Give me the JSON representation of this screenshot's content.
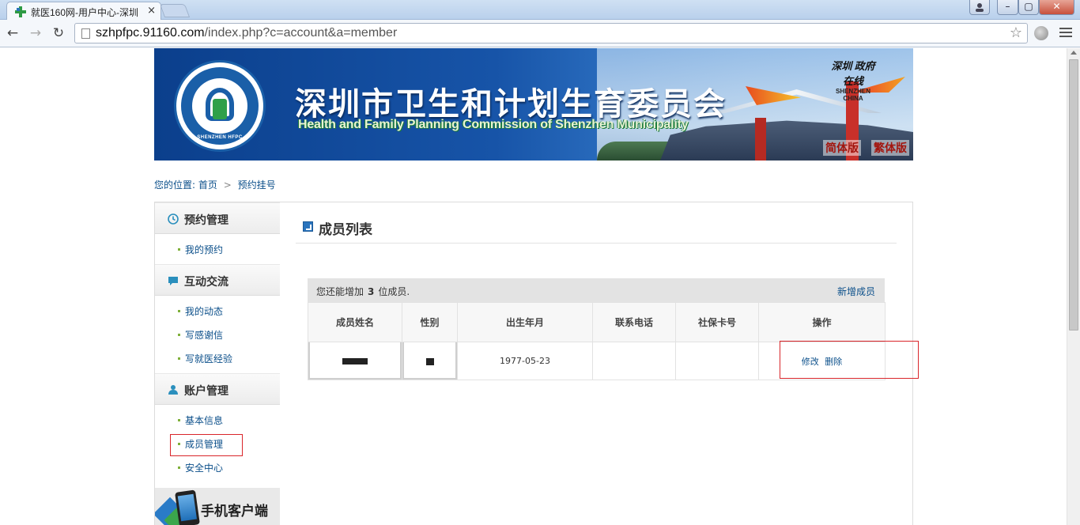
{
  "browser": {
    "tab_title": "就医160网-用户中心-深圳",
    "tab_close": "×",
    "url_host": "szhpfpc.91160.com",
    "url_path": "/index.php?c=account&a=member",
    "star": "☆",
    "win_min": "–",
    "win_max": "▢",
    "win_close": "✕",
    "icons": [
      "back-arrow-icon",
      "forward-arrow-icon",
      "reload-icon",
      "page-icon",
      "bookmark-star-icon",
      "extension-icon",
      "menu-icon"
    ]
  },
  "banner": {
    "cn_title": "深圳市卫生和计划生育委员会",
    "en_title": "Health and Family Planning Commission of Shenzhen Municipality",
    "emblem_text": "SHENZHEN HFPC",
    "sz_logo_cn": "深圳 政府在线",
    "sz_logo_en": "SHENZHEN CHINA",
    "lang_simplified": "简体版",
    "lang_traditional": "繁体版",
    "colors": {
      "primary": "#0b3f8c",
      "accent_red": "#a3150e"
    }
  },
  "breadcrumb": {
    "prefix": "您的位置:",
    "home": "首页",
    "separator": ">",
    "current": "预约挂号"
  },
  "sidebar": {
    "sections": [
      {
        "title": "预约管理",
        "icon": "clock-icon",
        "items": [
          {
            "label": "我的预约"
          }
        ]
      },
      {
        "title": "互动交流",
        "icon": "chat-bubble-icon",
        "items": [
          {
            "label": "我的动态"
          },
          {
            "label": "写感谢信"
          },
          {
            "label": "写就医经验"
          }
        ]
      },
      {
        "title": "账户管理",
        "icon": "user-icon",
        "items": [
          {
            "label": "基本信息"
          },
          {
            "label": "成员管理",
            "active": true
          },
          {
            "label": "安全中心"
          }
        ]
      }
    ],
    "app_promo": "手机客户端"
  },
  "main": {
    "title": "成员列表",
    "quota_prefix": "您还能增加",
    "quota_count": "3",
    "quota_suffix": "位成员.",
    "add_member": "新增成员",
    "columns": [
      "成员姓名",
      "性别",
      "出生年月",
      "联系电话",
      "社保卡号",
      "操作"
    ],
    "rows": [
      {
        "name": "",
        "gender": "",
        "birth": "1977-05-23",
        "phone": "",
        "ss_card": "",
        "edit": "修改",
        "delete": "删除"
      }
    ]
  },
  "colors": {
    "link": "#0b4f8a",
    "highlight_box": "#d9252a",
    "bullet": "#7fb03a"
  }
}
